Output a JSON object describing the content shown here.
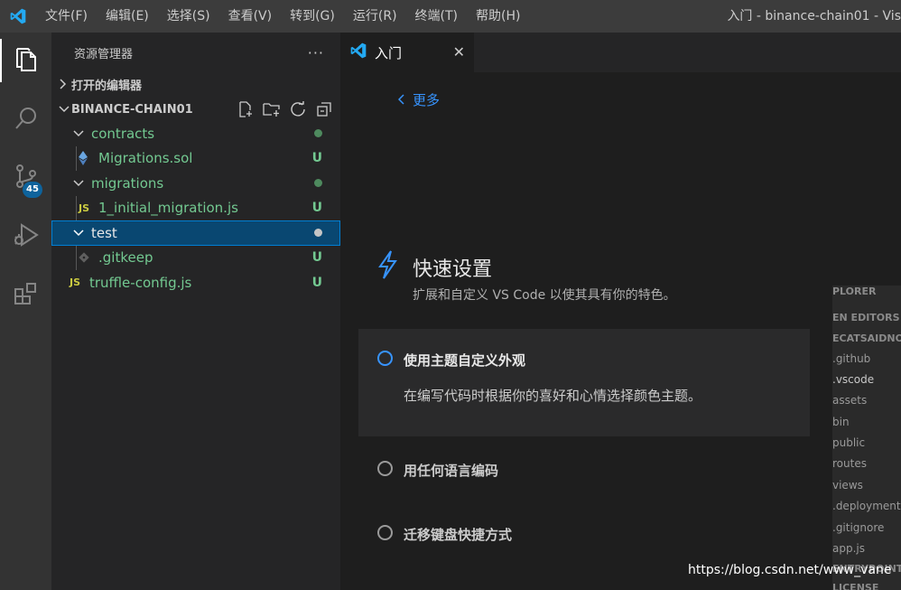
{
  "menu": [
    "文件(F)",
    "编辑(E)",
    "选择(S)",
    "查看(V)",
    "转到(G)",
    "运行(R)",
    "终端(T)",
    "帮助(H)"
  ],
  "window_title": "入门 - binance-chain01 - Vis",
  "activity": {
    "scm_badge": "45"
  },
  "sidebar": {
    "title": "资源管理器",
    "more": "···",
    "open_editors": "打开的编辑器",
    "workspace": "BINANCE-CHAIN01",
    "tree": [
      {
        "label": "contracts",
        "status": "dot"
      },
      {
        "label": "Migrations.sol",
        "status": "U"
      },
      {
        "label": "migrations",
        "status": "dot"
      },
      {
        "label": "1_initial_migration.js",
        "icon": "JS",
        "status": "U"
      },
      {
        "label": "test",
        "status": "dot"
      },
      {
        "label": ".gitkeep",
        "status": "U"
      },
      {
        "label": "truffle-config.js",
        "icon": "JS",
        "status": "U"
      }
    ]
  },
  "editor": {
    "tab_label": "入门",
    "tab_close": "✕",
    "back": "更多",
    "quick_setup": {
      "title": "快速设置",
      "subtitle": "扩展和自定义 VS Code 以使其具有你的特色。",
      "steps": [
        {
          "title": "使用主题自定义外观",
          "desc": "在编写代码时根据你的喜好和心情选择颜色主题。"
        },
        {
          "title": "用任何语言编码"
        },
        {
          "title": "迁移键盘快捷方式"
        }
      ]
    },
    "preview_lines": [
      "PLORER",
      "EN EDITORS",
      "ECATSAIDNO",
      ".github",
      ".vscode",
      "assets",
      "bin",
      "public",
      "routes",
      "views",
      ".deployment",
      ".gitignore",
      "app.js",
      "ENTRYPOINT",
      "LICENSE"
    ]
  },
  "watermark": "https://blog.csdn.net/www_vane",
  "colors": {
    "accent": "#3794ff",
    "untracked": "#73c991",
    "badge": "#0e639c",
    "selection": "#094771"
  }
}
